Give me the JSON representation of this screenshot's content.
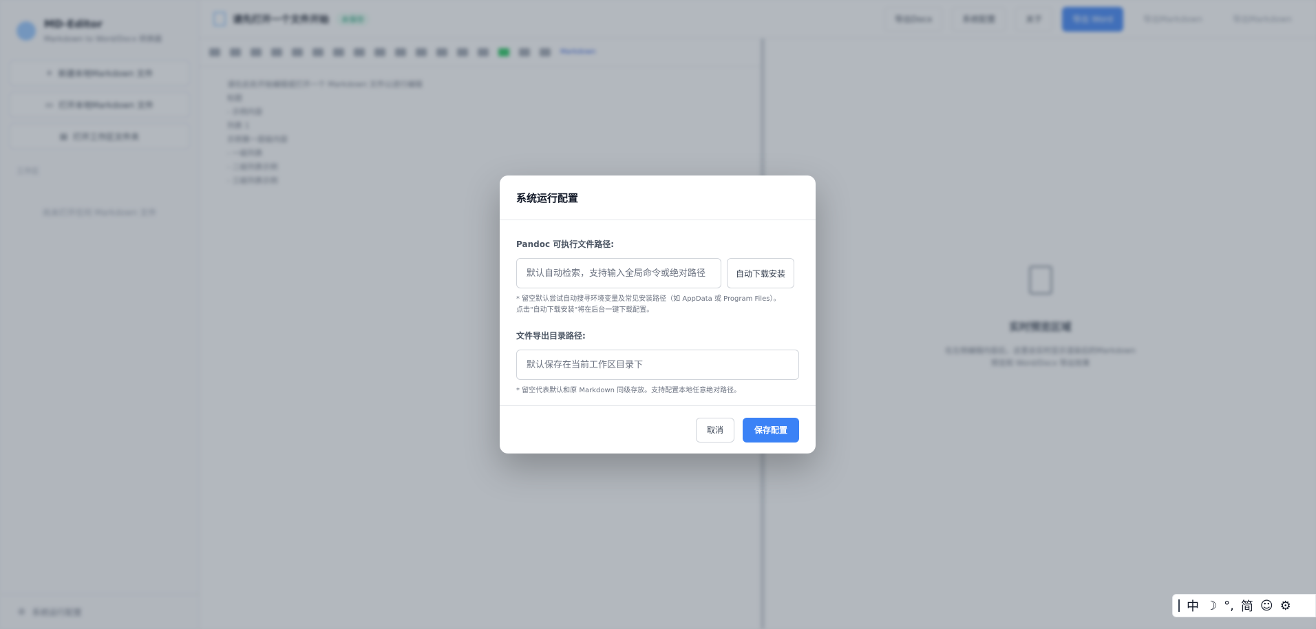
{
  "app": {
    "brand_title": "MD-Editor",
    "brand_sub": "Markdown to Word/Docx 转换器",
    "sidebar_buttons": [
      "新建本地Markdown 文件",
      "打开本地Markdown 文件",
      "打开工作区文件夹"
    ],
    "sidebar_section": "工作区",
    "sidebar_empty": "尚未打开任何 Markdown 文件",
    "sidebar_footer": "系统运行配置",
    "doc_title": "请先打开一个文件开始",
    "doc_tag": "未保存",
    "top_buttons": [
      "导出Docx",
      "系统配置",
      "关于",
      "导出 Word",
      "导出Markdown",
      "导出Markdown"
    ],
    "editor_mode": "Markdown",
    "editor_lines": [
      "请在此处开始编辑或打开一个 Markdown 文件以进行编辑",
      "标题",
      "- 示例内容",
      "列表 1",
      "  示例第一层级内容",
      "  - 一级列表",
      "  - 二级列表示例",
      "  - 三级列表示例"
    ],
    "preview_title": "实时预览区域",
    "preview_desc_1": "在左侧编辑内容后，这里会实时显示渲染后的Markdown",
    "preview_desc_2": "预览和 Word/Docx 导出效果"
  },
  "modal": {
    "title": "系统运行配置",
    "pandoc_label": "Pandoc 可执行文件路径:",
    "pandoc_placeholder": "默认自动检索，支持输入全局命令或绝对路径",
    "pandoc_value": "",
    "auto_install": "自动下载安装",
    "pandoc_hint_1": "* 留空默认尝试自动搜寻环境变量及常见安装路径（如 AppData 或 Program Files）。",
    "pandoc_hint_2": "点击\"自动下载安装\"将在后台一键下载配置。",
    "export_label": "文件导出目录路径:",
    "export_placeholder": "默认保存在当前工作区目录下",
    "export_value": "",
    "export_hint": "* 留空代表默认和原 Markdown 同级存放。支持配置本地任意绝对路径。",
    "cancel": "取消",
    "save": "保存配置"
  },
  "ime": {
    "lang": "中",
    "mode_icon": "moon-icon",
    "punct": "°,",
    "variant": "简",
    "emoji_icon": "smiley-icon",
    "settings_icon": "gear-icon"
  }
}
